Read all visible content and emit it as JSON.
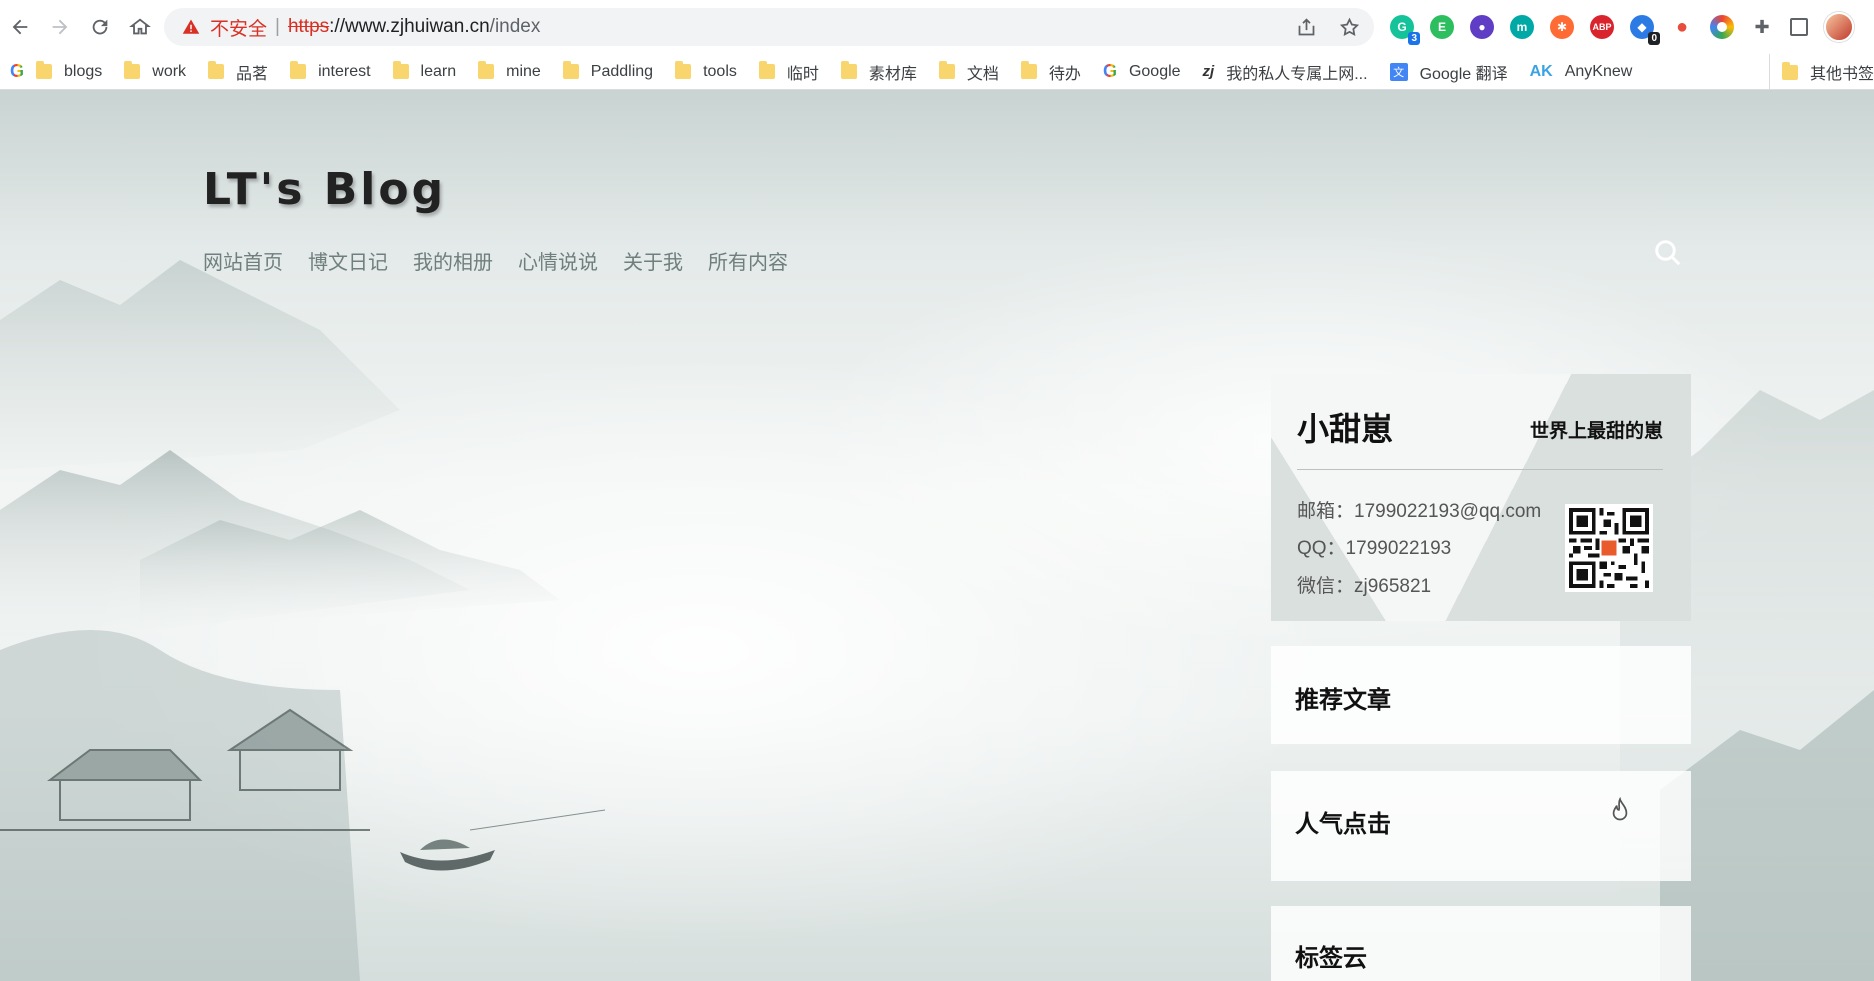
{
  "browser": {
    "security_label": "不安全",
    "separator": "|",
    "url_scheme": "https",
    "url_host": "://www.zjhuiwan.cn",
    "url_path": "/index",
    "extensions": [
      {
        "name": "grammarly-extension",
        "color": "#15c39a",
        "badge": "3"
      },
      {
        "name": "evernote-extension",
        "color": "#2dbe60",
        "badge": ""
      },
      {
        "name": "screen-recorder-extension",
        "color": "#5f3dc4",
        "badge": ""
      },
      {
        "name": "m-extension",
        "color": "#00a9a5",
        "badge": ""
      },
      {
        "name": "orange-extension",
        "color": "#ff6b35",
        "badge": ""
      },
      {
        "name": "adblock-plus-extension",
        "color": "#d9232d",
        "badge": ""
      },
      {
        "name": "blue-tool-extension",
        "color": "#2c7be5",
        "badge": "0"
      },
      {
        "name": "red-drop-extension",
        "color": "#e74c3c",
        "badge": ""
      },
      {
        "name": "colorful-ring-extension",
        "color": "#f4b400",
        "badge": ""
      }
    ]
  },
  "bookmarks": {
    "items": [
      {
        "type": "folder",
        "label": "blogs"
      },
      {
        "type": "folder",
        "label": "work"
      },
      {
        "type": "folder",
        "label": "品茗"
      },
      {
        "type": "folder",
        "label": "interest"
      },
      {
        "type": "folder",
        "label": "learn"
      },
      {
        "type": "folder",
        "label": "mine"
      },
      {
        "type": "folder",
        "label": "Paddling"
      },
      {
        "type": "folder",
        "label": "tools"
      },
      {
        "type": "folder",
        "label": "临时"
      },
      {
        "type": "folder",
        "label": "素材库"
      },
      {
        "type": "folder",
        "label": "文档"
      },
      {
        "type": "folder",
        "label": "待办"
      }
    ],
    "links": {
      "google": "Google",
      "zj": "我的私人专属上网...",
      "translate": "Google 翻译",
      "anyknew": "AnyKnew",
      "anyknew_icon": "AK"
    },
    "more": "»",
    "other": "其他书签"
  },
  "site": {
    "title": "LT's Blog",
    "nav": [
      "网站首页",
      "博文日记",
      "我的相册",
      "心情说说",
      "关于我",
      "所有内容"
    ]
  },
  "profile": {
    "name": "小甜崽",
    "motto": "世界上最甜的崽",
    "email": "邮箱：1799022193@qq.com",
    "qq": "QQ：1799022193",
    "wechat": "微信：zj965821"
  },
  "sidebar": {
    "recommended": "推荐文章",
    "popular": "人气点击",
    "tags": "标签云"
  },
  "colors": {
    "insecure": "#d93025",
    "nav_text": "#6f7f7d",
    "title_text": "#222222"
  }
}
